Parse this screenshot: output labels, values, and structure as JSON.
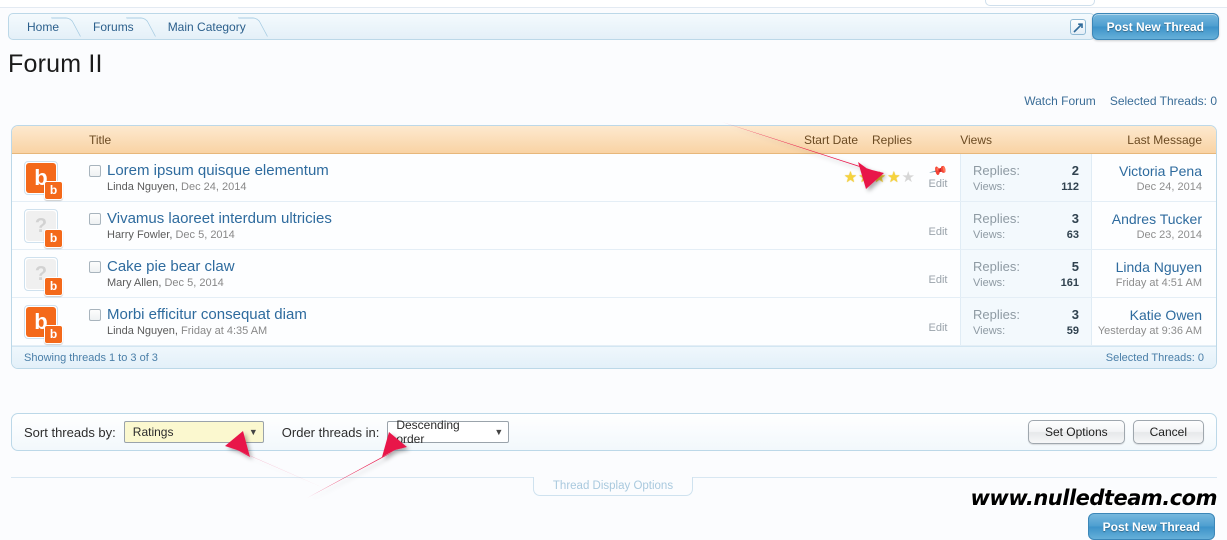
{
  "breadcrumb": {
    "items": [
      {
        "label": "Home"
      },
      {
        "label": "Forums"
      },
      {
        "label": "Main Category"
      }
    ],
    "popup_icon": "popup-expand-icon"
  },
  "header": {
    "post_new_thread": "Post New Thread",
    "page_title": "Forum II"
  },
  "links": {
    "watch_forum": "Watch Forum",
    "selected_threads": "Selected Threads: 0"
  },
  "table": {
    "columns": {
      "title": "Title",
      "start_date": "Start Date",
      "replies": "Replies",
      "views": "Views",
      "last_message": "Last Message"
    },
    "labels": {
      "replies": "Replies:",
      "views": "Views:",
      "edit": "Edit"
    },
    "rows": [
      {
        "avatar_type": "orange",
        "avatar_glyph": "b",
        "badge_glyph": "b",
        "title": "Lorem ipsum quisque elementum",
        "author": "Linda Nguyen,",
        "date": "Dec 24, 2014",
        "rating": 4,
        "rating_max": 5,
        "pinned": true,
        "replies": "2",
        "views": "112",
        "last_user": "Victoria Pena",
        "last_date": "Dec 24, 2014"
      },
      {
        "avatar_type": "grey",
        "avatar_glyph": "?",
        "badge_glyph": "b",
        "title": "Vivamus laoreet interdum ultricies",
        "author": "Harry Fowler,",
        "date": "Dec 5, 2014",
        "rating": 0,
        "rating_max": 5,
        "pinned": false,
        "replies": "3",
        "views": "63",
        "last_user": "Andres Tucker",
        "last_date": "Dec 23, 2014"
      },
      {
        "avatar_type": "grey",
        "avatar_glyph": "?",
        "badge_glyph": "b",
        "title": "Cake pie bear claw",
        "author": "Mary Allen,",
        "date": "Dec 5, 2014",
        "rating": 0,
        "rating_max": 5,
        "pinned": false,
        "replies": "5",
        "views": "161",
        "last_user": "Linda Nguyen",
        "last_date": "Friday at 4:51 AM"
      },
      {
        "avatar_type": "orange",
        "avatar_glyph": "b",
        "badge_glyph": "b",
        "title": "Morbi efficitur consequat diam",
        "author": "Linda Nguyen,",
        "date": "Friday at 4:35 AM",
        "rating": 0,
        "rating_max": 5,
        "pinned": false,
        "replies": "3",
        "views": "59",
        "last_user": "Katie Owen",
        "last_date": "Yesterday at 9:36 AM"
      }
    ],
    "footer": {
      "showing": "Showing threads 1 to 3 of 3",
      "selected": "Selected Threads: 0"
    }
  },
  "options": {
    "sort_label": "Sort threads by:",
    "sort_value": "Ratings",
    "order_label": "Order threads in:",
    "order_value": "Descending order",
    "set_options": "Set Options",
    "cancel": "Cancel"
  },
  "bottom": {
    "tab_label": "Thread Display Options",
    "post_new_thread": "Post New Thread",
    "watermark": "www.nulledteam.com"
  },
  "colors": {
    "accent_blue": "#3d93c9",
    "header_peach": "#f9d3a4",
    "avatar_orange": "#f4691a",
    "star_gold": "#f6d33c",
    "arrow_red": "#e8174a"
  }
}
